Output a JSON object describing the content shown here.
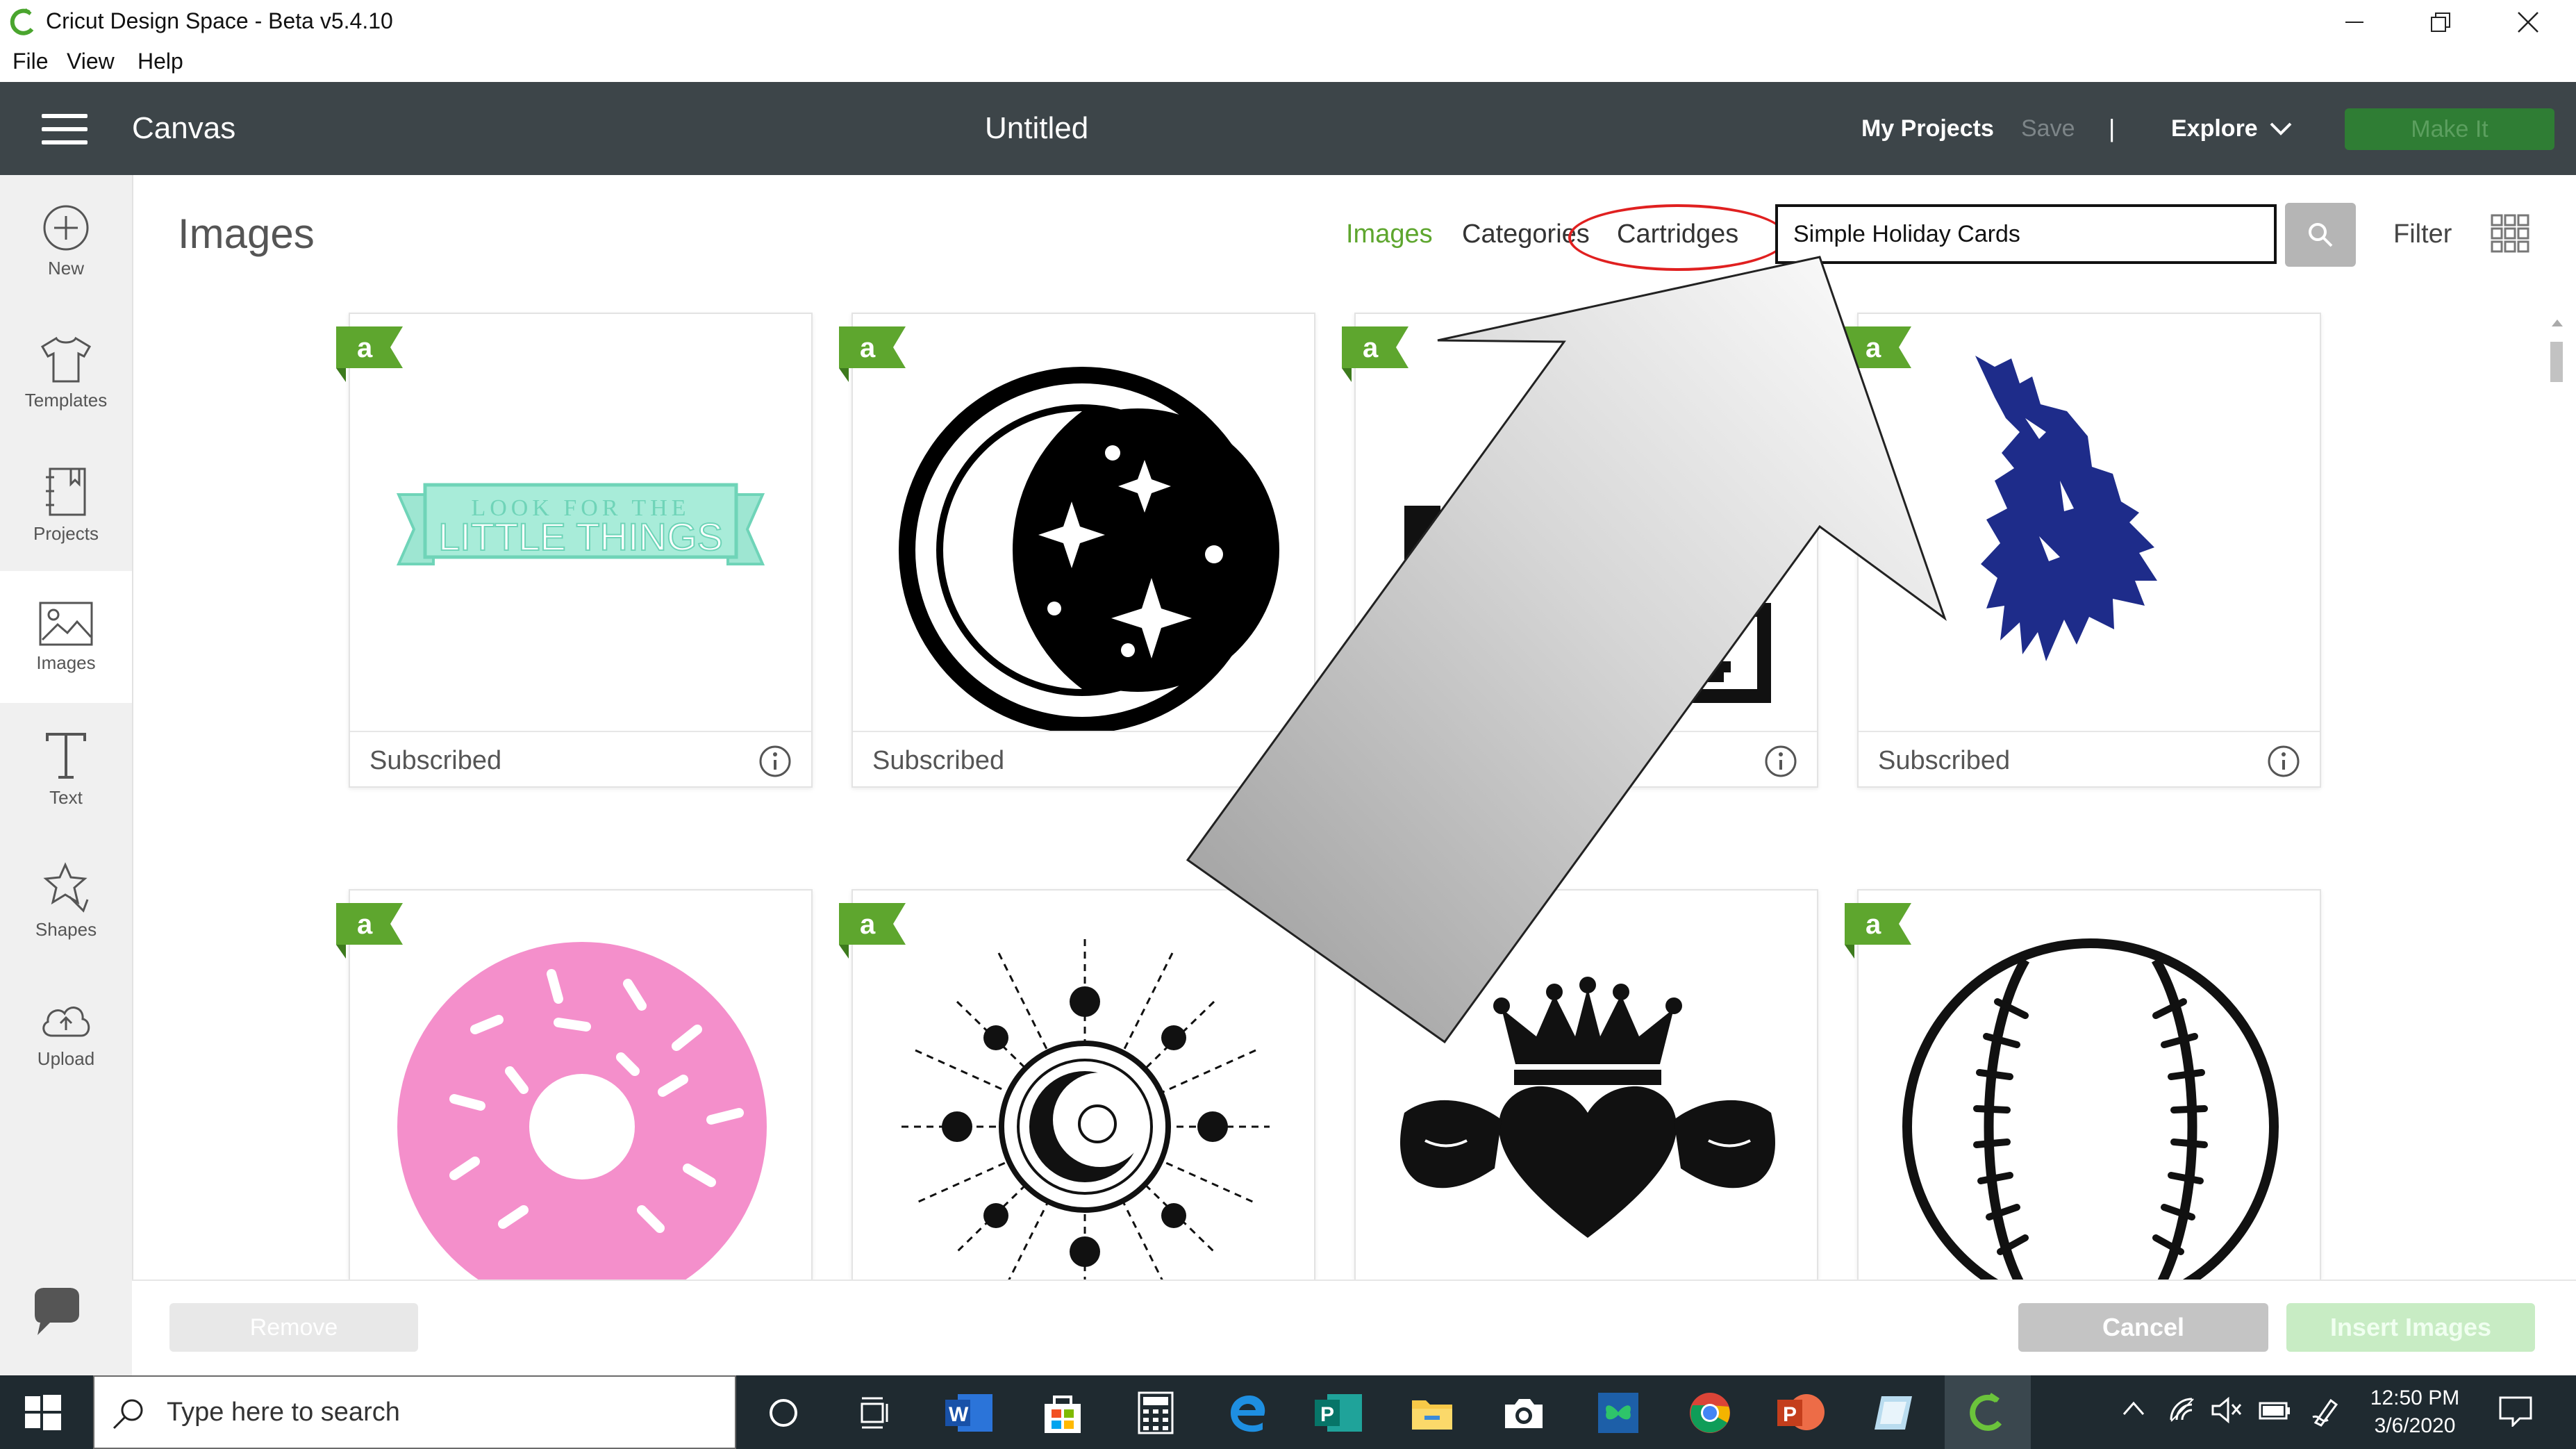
{
  "window": {
    "title": "Cricut Design Space - Beta v5.4.10",
    "menu": [
      "File",
      "View",
      "Help"
    ]
  },
  "header": {
    "canvas_label": "Canvas",
    "doc_title": "Untitled",
    "my_projects": "My Projects",
    "save": "Save",
    "separator": "|",
    "explore": "Explore",
    "make_it": "Make It"
  },
  "rail": [
    {
      "label": "New",
      "icon": "plus-circle-icon"
    },
    {
      "label": "Templates",
      "icon": "tshirt-icon"
    },
    {
      "label": "Projects",
      "icon": "notebook-icon"
    },
    {
      "label": "Images",
      "icon": "image-icon"
    },
    {
      "label": "Text",
      "icon": "text-icon"
    },
    {
      "label": "Shapes",
      "icon": "shapes-icon"
    },
    {
      "label": "Upload",
      "icon": "cloud-upload-icon"
    }
  ],
  "panel": {
    "title": "Images",
    "tabs": [
      "Images",
      "Categories",
      "Cartridges"
    ],
    "active_tab": "Images",
    "search_value": "Simple Holiday Cards",
    "filter": "Filter"
  },
  "cards": [
    {
      "caption": "Subscribed",
      "image": "little-things-banner",
      "banner_line1": "LOOK FOR THE",
      "banner_line2": "LITTLE THINGS"
    },
    {
      "caption": "Subscribed",
      "image": "crescent-moon-stars"
    },
    {
      "caption": "",
      "image": "framed-picture"
    },
    {
      "caption": "Subscribed",
      "image": "howling-wolf"
    },
    {
      "caption": "",
      "image": "pink-donut"
    },
    {
      "caption": "",
      "image": "celestial-sun-moon"
    },
    {
      "caption": "",
      "image": "claddagh-crown-heart"
    },
    {
      "caption": "",
      "image": "baseball"
    }
  ],
  "bottom": {
    "remove": "Remove",
    "cancel": "Cancel",
    "insert": "Insert Images"
  },
  "taskbar": {
    "search_placeholder": "Type here to search",
    "time": "12:50 PM",
    "date": "3/6/2020"
  },
  "colors": {
    "header_bg": "#3d4549",
    "accent_green": "#5ea62e",
    "annotation_red": "#e02020",
    "badge_green": "#5ea62e"
  }
}
